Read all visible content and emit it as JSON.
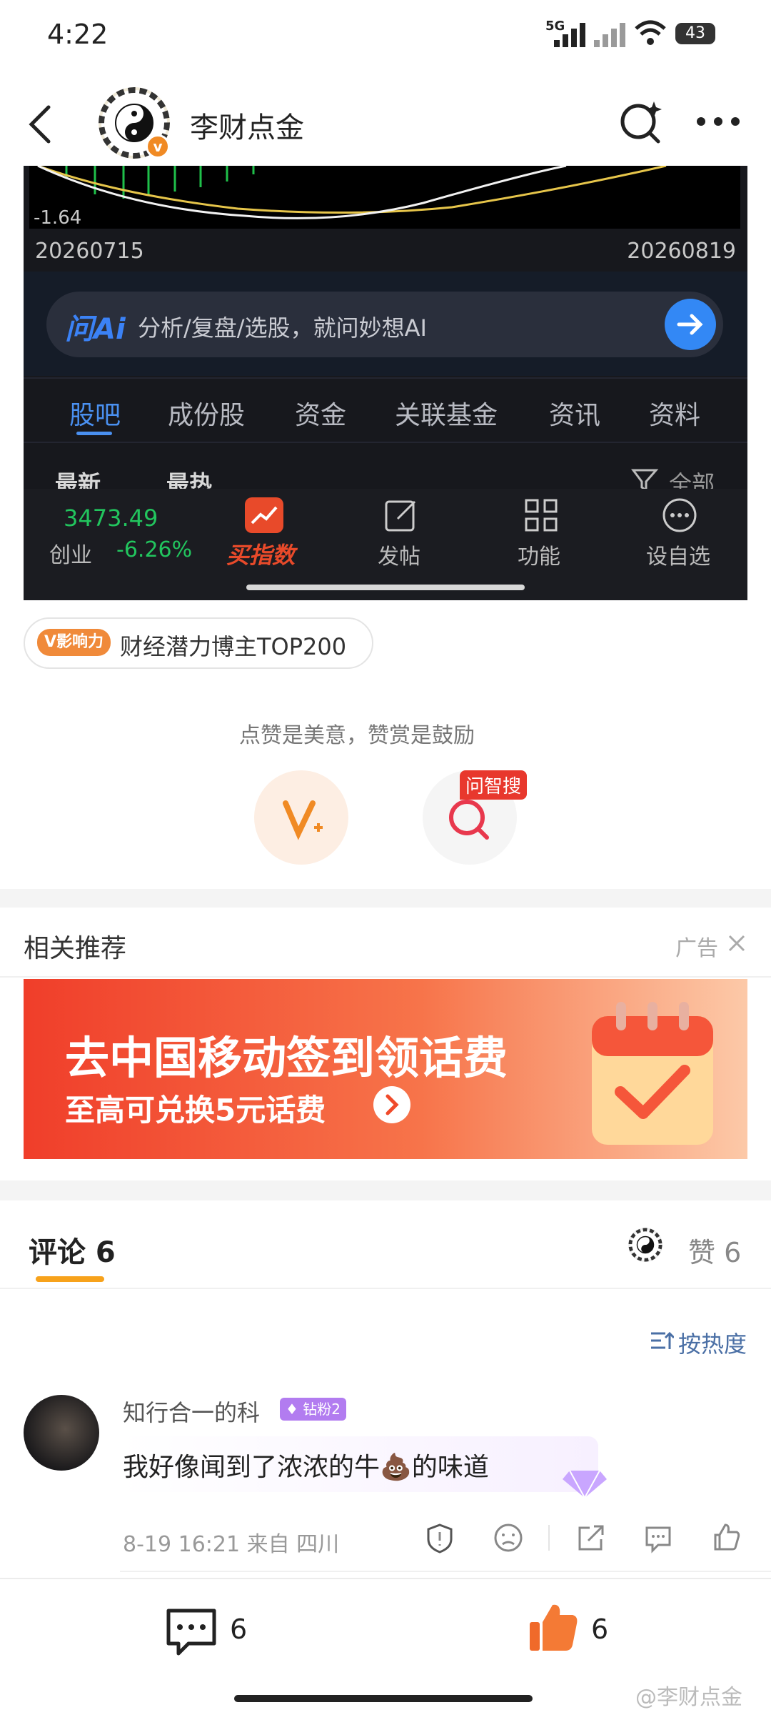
{
  "status_bar": {
    "time": "4:22",
    "network": "5G",
    "battery": "43"
  },
  "header": {
    "title": "李财点金"
  },
  "screenshot": {
    "chart_min_label": "-1.64",
    "date_start": "20260715",
    "date_end": "20260819",
    "ai_logo": "问Ai",
    "ai_placeholder": "分析/复盘/选股，就问妙想AI",
    "tabs": [
      "股吧",
      "成份股",
      "资金",
      "关联基金",
      "资讯",
      "资料"
    ],
    "subtabs": {
      "latest": "最新",
      "hot": "最热",
      "all": "全部"
    },
    "index_value": "3473.49",
    "index_name": "创业",
    "index_change": "-6.26%",
    "buy_index": "买指数",
    "actions": [
      "发帖",
      "功能",
      "设自选"
    ]
  },
  "badge": {
    "tag": "V影响力",
    "text": "财经潜力博主TOP200"
  },
  "reward": {
    "prompt": "点赞是美意，赞赏是鼓励",
    "search_tag": "问智搜"
  },
  "related": {
    "title": "相关推荐",
    "ad_label": "广告"
  },
  "ad": {
    "title": "去中国移动签到领话费",
    "subtitle": "至高可兑换5元话费"
  },
  "comments": {
    "tab_label": "评论 6",
    "likes_label": "赞 6",
    "sort_label": "按热度",
    "items": [
      {
        "user": "知行合一的科",
        "fan_badge": "钻粉2",
        "text_before": "我好像闻到了浓浓的牛",
        "emoji": "💩",
        "text_after": "的味道",
        "meta": "8-19 16:21 来自 四川"
      }
    ]
  },
  "bottom_bar": {
    "comment_count": "6",
    "like_count": "6"
  },
  "watermark": "@李财点金"
}
